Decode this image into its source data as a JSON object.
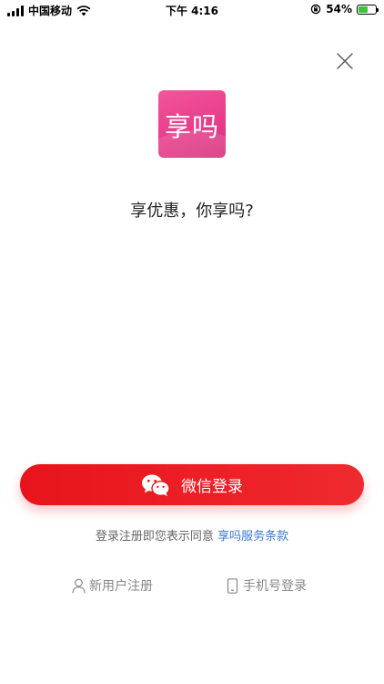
{
  "status_bar": {
    "carrier": "中国移动",
    "time": "下午 4:16",
    "battery_percent": "54%",
    "battery_level": 0.54,
    "battery_color": "#3ac43a"
  },
  "app": {
    "logo_text": "享吗",
    "tagline": "享优惠，你享吗?",
    "brand_color": "#e83e8c"
  },
  "login": {
    "wechat_label": "微信登录",
    "button_color": "#e8141b"
  },
  "agreement": {
    "text": "登录注册即您表示同意",
    "link": "享吗服务条款"
  },
  "bottom_links": {
    "register": "新用户注册",
    "phone_login": "手机号登录"
  },
  "icons": {
    "close": "close-icon",
    "wechat": "wechat-icon",
    "user": "user-icon",
    "phone": "phone-icon"
  }
}
